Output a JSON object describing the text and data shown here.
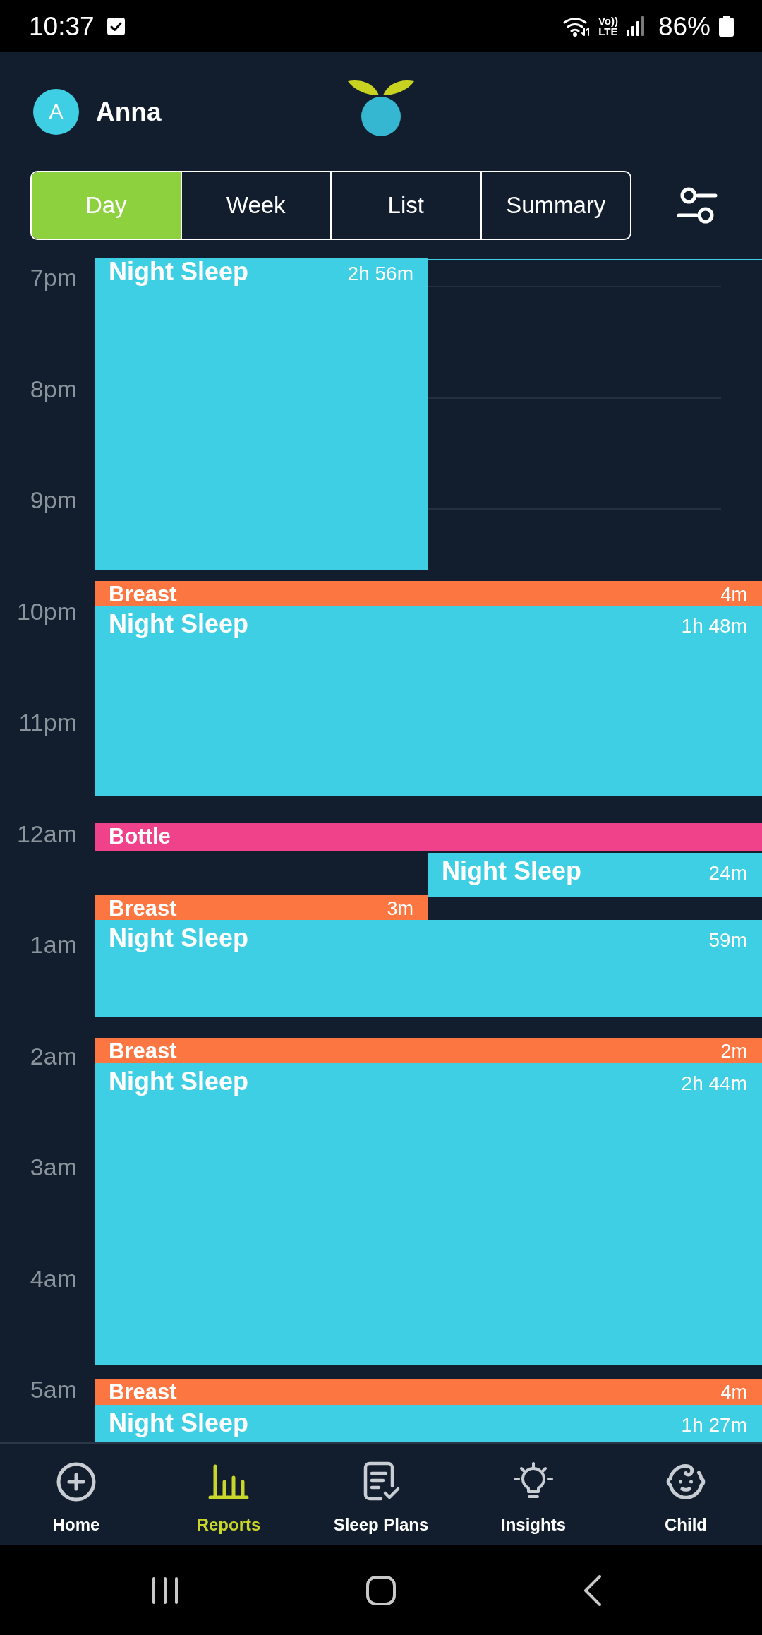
{
  "status_bar": {
    "time": "10:37",
    "volte": "Vo))",
    "network": "LTE",
    "battery": "86%"
  },
  "header": {
    "avatar_initial": "A",
    "child_name": "Anna"
  },
  "tabs": [
    {
      "label": "Day",
      "selected": true
    },
    {
      "label": "Week",
      "selected": false
    },
    {
      "label": "List",
      "selected": false
    },
    {
      "label": "Summary",
      "selected": false
    }
  ],
  "timeline": {
    "hours": [
      "7pm",
      "8pm",
      "9pm",
      "10pm",
      "11pm",
      "12am",
      "1am",
      "2am",
      "3am",
      "4am",
      "5am"
    ],
    "events": [
      {
        "kind": "sleep",
        "title": "Night Sleep",
        "duration": "2h 56m",
        "color": "#3ecfe4"
      },
      {
        "kind": "feed",
        "title": "Breast",
        "duration": "4m",
        "color": "#fb7641"
      },
      {
        "kind": "sleep",
        "title": "Night Sleep",
        "duration": "1h 48m",
        "color": "#3ecfe4"
      },
      {
        "kind": "feed",
        "title": "Bottle",
        "color": "#f0428a"
      },
      {
        "kind": "sleep",
        "title": "Night Sleep",
        "duration": "24m",
        "color": "#3ecfe4"
      },
      {
        "kind": "feed",
        "title": "Breast",
        "duration": "3m",
        "color": "#fb7641"
      },
      {
        "kind": "sleep",
        "title": "Night Sleep",
        "duration": "59m",
        "color": "#3ecfe4"
      },
      {
        "kind": "feed",
        "title": "Breast",
        "duration": "2m",
        "color": "#fb7641"
      },
      {
        "kind": "sleep",
        "title": "Night Sleep",
        "duration": "2h 44m",
        "color": "#3ecfe4"
      },
      {
        "kind": "feed",
        "title": "Breast",
        "duration": "4m",
        "color": "#fb7641"
      },
      {
        "kind": "sleep",
        "title": "Night Sleep",
        "duration": "1h 27m",
        "color": "#3ecfe4"
      }
    ]
  },
  "bottom_nav": [
    {
      "label": "Home",
      "selected": false
    },
    {
      "label": "Reports",
      "selected": true
    },
    {
      "label": "Sleep Plans",
      "selected": false
    },
    {
      "label": "Insights",
      "selected": false
    },
    {
      "label": "Child",
      "selected": false
    }
  ]
}
